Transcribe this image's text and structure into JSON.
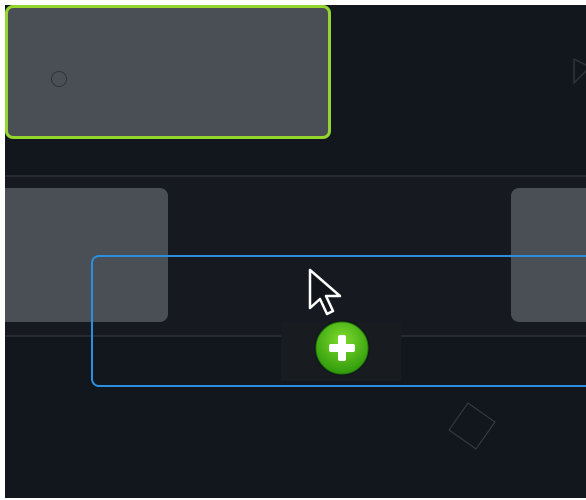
{
  "canvas": {
    "background_color": "#12161d",
    "page_border_color": "#ffffff"
  },
  "decorations": {
    "circle_icon": "circle-outline-icon",
    "triangle_icon": "triangle-outline-icon",
    "diamond_icon": "diamond-outline-icon"
  },
  "timeline": {
    "track_color": "#16191f",
    "clip_color": "#4a4f55",
    "clips": [
      {
        "id": "left",
        "selected": false
      },
      {
        "id": "center",
        "selected": true,
        "outline_color": "#95d62e"
      },
      {
        "id": "right",
        "selected": false
      }
    ]
  },
  "drag": {
    "drop_target_color": "#2b8fe0",
    "cursor_icon": "arrow-cursor-icon",
    "badge_icon": "plus-icon",
    "badge_color": "#3fae12"
  }
}
